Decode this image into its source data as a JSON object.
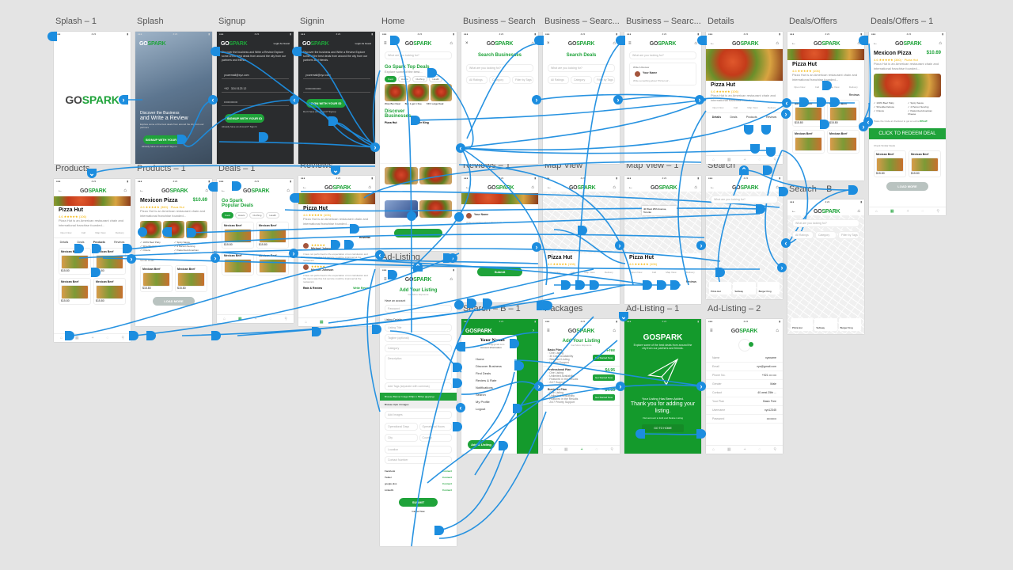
{
  "canvas": {
    "background": "#e4e4e4",
    "wire_color": "#1c8ddf",
    "accent": "#1fa33a"
  },
  "brand": {
    "logo_a": "GO",
    "logo_b": "SPARK"
  },
  "artboards": {
    "splash1": {
      "label": "Splash – 1"
    },
    "splash": {
      "label": "Splash",
      "headline1": "Discover the Business",
      "headline2": "and Write a Review",
      "blurb": "Explore some of the best deals from around the city from our partners",
      "cta": "SIGNUP WITH YOUR ID",
      "footer": "Already have an account? Sign in"
    },
    "signup": {
      "label": "Signup",
      "guest": "Login As Guest",
      "intro": "Discover the business and Write a Review Explore some of the best deals from around the city from our partners and friends.",
      "email": "youremail@xyz.com",
      "phone_code": "+92",
      "phone": "324 0123 12",
      "password": "••••••••••••••",
      "cta": "SIGNUP WITH YOUR ID",
      "footer": "Already have an Account? Sign In"
    },
    "signin": {
      "label": "Signin",
      "guest": "Login As Guest",
      "intro": "Discover the business and Write a Review Explore some of the best deals from around the city from our partners and friends.",
      "email": "youremail@xyz.com",
      "password": "••••••••••••••••",
      "cta": "SIGN WITH YOUR ID",
      "footer": "Don't have an account? Signup"
    },
    "home": {
      "label": "Home",
      "search_placeholder": "What are you looking for?",
      "top_deals": "Go Spark Top Deals",
      "top_deals_sub": "Explore some of the best...",
      "see_all": "See all",
      "chips": [
        "Food",
        "Hotels",
        "Clothing",
        "Health",
        "Deals"
      ],
      "items": [
        "Wow Box Deal",
        "Buy 1 get 1 free",
        "KFC Large Deal"
      ],
      "discover": "Discover Businesses",
      "biz": [
        "Pizza Hut",
        "Burger King"
      ]
    },
    "business_search": {
      "label": "Business – Search",
      "title": "Search Businesses",
      "placeholder": "What are you looking for?",
      "filters": [
        "All Ratings",
        "Category",
        "Filter by Tags"
      ]
    },
    "business_search2": {
      "label": "Business – Searc...",
      "title": "Search Deals",
      "placeholder": "What are you looking for?",
      "filters": [
        "All Ratings",
        "Category",
        "Filter by Tags"
      ]
    },
    "business_search3": {
      "label": "Business – Searc...",
      "placeholder": "What are you looking for?",
      "section": "Write A Review",
      "user": "Your Name",
      "prompt": "Write something about 'Pizza Hut'..."
    },
    "details": {
      "label": "Details",
      "name": "Pizza Hut",
      "rating": "4.6",
      "count": "(106)",
      "desc": "Pizza Hut is an American restaurant chain and international franchise founded...",
      "actions": [
        "Open Now",
        "Call",
        "Map View",
        "Delivery"
      ],
      "tabs": [
        "Details",
        "Deals",
        "Products",
        "Reviews"
      ]
    },
    "deals_offers": {
      "label": "Deals/Offers",
      "name": "Pizza Hut",
      "rating": "4.6",
      "count": "(106)",
      "desc": "Pizza Hut is an American restaurant chain and international franchise founded...",
      "actions": [
        "Open Now",
        "Call",
        "Map View",
        "Delivery"
      ],
      "tabs": [
        "Reviews"
      ],
      "item": "Mexican Beef",
      "price": "$15.80"
    },
    "deals_offers1": {
      "label": "Deals/Offers – 1",
      "name": "Mexicon Pizza",
      "price": "$10.69",
      "rating": "4.6",
      "meta": "(360) · Pizza Hut",
      "desc": "Pizza Hut is an American restaurant chain and international franchise founded...",
      "features": [
        "100% Beef Patty",
        "Shredded lettuce",
        "Onions",
        "Spicy Sauce",
        "4 Person Serving",
        "Pasturized American Cheese"
      ],
      "promo_text": "Paste the Code at checkout to get an extra",
      "promo_code": "20%off",
      "redeem": "CLICK TO REDEEM DEAL",
      "similar": "Check Similar Deals",
      "item": "Mexican Beef",
      "price2": "$15.80",
      "load_more": "LOAD MORE"
    },
    "products": {
      "label": "Products",
      "name": "Pizza Hut",
      "rating": "4.6",
      "count": "(106)",
      "desc": "Pizza Hut is an American restaurant chain and international franchise founded...",
      "actions": [
        "Open Now",
        "Call",
        "Map View",
        "Delivery"
      ],
      "tabs": [
        "Details",
        "Deals",
        "Products",
        "Reviews"
      ],
      "item": "Mexican Beef",
      "price": "$15.80"
    },
    "products1": {
      "label": "Products – 1",
      "name": "Mexicon Pizza",
      "price": "$10.69",
      "rating": "4.6",
      "meta": "(360) · Pizza Hut",
      "desc": "Pizza Hut is an American restaurant chain and international franchise founded...",
      "features": [
        "100% Beef Patty",
        "Shredded lettuce",
        "Onions",
        "Spicy Sauce",
        "4 Person Serving",
        "Pasturized American Cheese"
      ],
      "similar": "Similar Deals",
      "item": "Mexican Beef",
      "price2": "$15.80",
      "load_more": "LOAD MORE"
    },
    "deals1": {
      "label": "Deals – 1",
      "title": "Go Spark Popular Deals",
      "chips": [
        "Food",
        "Hotels",
        "Clothing",
        "Health",
        "Deals"
      ],
      "item": "Mexican Beef",
      "price": "$15.80"
    },
    "reviews": {
      "label": "Reviews",
      "name": "Pizza Hut",
      "rating": "4.6",
      "count": "(106)",
      "desc": "Pizza Hut is an American restaurant chain and international franchise founded...",
      "tab": "Reviews",
      "reviewers": [
        "Michael Johnson",
        "Michael Johnson"
      ],
      "review_text": "I have not performed to the expectation of our calculators and the menu was fine but service could be improved at the restaurant.",
      "rate": "Rate & Review",
      "write": "Write Review"
    },
    "reviews1": {
      "label": "Reviews – 1",
      "user": "Your Name",
      "prompt": "Write something about 'Pizza Hut'...",
      "submit": "Submit"
    },
    "map_view": {
      "label": "Map View",
      "name": "Pizza Hut",
      "rating": "4.6",
      "count": "(106)",
      "actions": [
        "Open Now",
        "Call",
        "Map View",
        "Delivery"
      ]
    },
    "map_view1": {
      "label": "Map View – 1",
      "pin": "40 West 25th Avenue, Toronto",
      "name": "Pizza Hut",
      "rating": "4.6",
      "count": "(106)",
      "actions": [
        "Open Now",
        "Call",
        "Map View",
        "Delivery"
      ],
      "tab": "Reviews"
    },
    "search": {
      "label": "Search",
      "placeholder": "What are you looking for?",
      "places": [
        "Pizza Hut",
        "Subway",
        "Burger King"
      ]
    },
    "search_b": {
      "label": "Search – B",
      "placeholder": "What are you looking for?",
      "filters": [
        "All Ratings",
        "Category",
        "Filter by Tags"
      ],
      "places": [
        "Pizza Hut",
        "Subway",
        "Burger King"
      ]
    },
    "ad_listing": {
      "label": "Ad-Listing",
      "title": "Add Your Listing",
      "subtitle": "Get More Exposure",
      "section1": "Have an account",
      "password": "Password",
      "section2": "Listing Details",
      "fields": [
        "Listing Title",
        "Tagline (optional)",
        "Category",
        "Description"
      ],
      "tags": "Add Tags (separate with commas)",
      "upload": "Browse Banner Image 600px x 500px (jpg/png)",
      "section3": "Browse Upto 4 Images",
      "fields2": [
        "Add Images",
        "Operational Days",
        "Operational Hours",
        "City",
        "Country",
        "Location",
        "Contact Number"
      ],
      "social": [
        "Facebook",
        "Twitter",
        "google plus",
        "LinkedIn"
      ],
      "connect": "Connect",
      "submit": "SUBMIT",
      "cancel": "Cancel Now"
    },
    "search_b1": {
      "label": "Search – B – 1",
      "user": "Your Name",
      "email": "your.email@gmail.com",
      "account": "Account Information",
      "menu": [
        "Home",
        "Discover Business",
        "Find Deals",
        "Review & Rate",
        "Notifications",
        "Search",
        "My Profile",
        "Logout"
      ],
      "cta": "Add A Listing"
    },
    "packages": {
      "label": "Packages",
      "title": "Add Your Listing",
      "subtitle": "Get More Exposure",
      "plans": [
        {
          "name": "Basic Plan",
          "price": "Free",
          "perks": [
            "One Listing",
            "30 Days Availability",
            "Standard Listing",
            "Limited Support"
          ]
        },
        {
          "name": "Professional Plan",
          "price": "$4.95",
          "perks": [
            "One Listing",
            "Unlimited Availability",
            "Featured in the Results",
            "24/7 Support"
          ]
        },
        {
          "name": "Business Plan",
          "price": "$7.95",
          "perks": [
            "One Listing",
            "Unlimited Availability",
            "Featured in the Results",
            "24/7 Priority Support"
          ]
        }
      ],
      "cta": "Get Started Now"
    },
    "ad_listing1": {
      "label": "Ad-Listing – 1",
      "intro": "Explore some of the best deals from around the city from our partners and friends.",
      "line1": "Your Listing Has Been Added.",
      "line2": "Thank you for adding your listing.",
      "note": "Visit account to Edit and Delete Listing",
      "cta": "GO TO HOME"
    },
    "ad_listing2": {
      "label": "Ad-Listing – 2",
      "rows": [
        {
          "k": "Name",
          "v": "xyzname"
        },
        {
          "k": "Email",
          "v": "xyz@gmail.com"
        },
        {
          "k": "Phone No.",
          "v": "+921 ••• ••••"
        },
        {
          "k": "Gender",
          "v": "Male"
        },
        {
          "k": "Contact",
          "v": "40 west 25th ..."
        },
        {
          "k": "Your Plan",
          "v": "Basic Free"
        },
        {
          "k": "Username",
          "v": "xyz12345"
        },
        {
          "k": "Password",
          "v": "••••••••••"
        }
      ]
    }
  },
  "icons": {
    "back": "←",
    "menu": "≡",
    "cart": "⌂",
    "next": "›",
    "prev": "‹",
    "down": "⌄",
    "up": "⌃",
    "home": "⌂",
    "grid": "▦",
    "plus": "+",
    "chat": "◌",
    "search": "⚲"
  }
}
